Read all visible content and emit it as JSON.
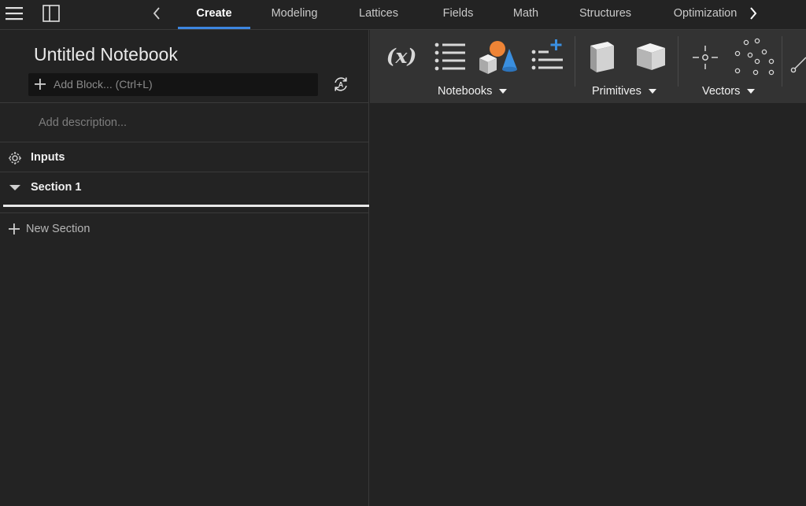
{
  "topbar": {
    "tabs": [
      {
        "label": "Create",
        "active": true
      },
      {
        "label": "Modeling",
        "active": false
      },
      {
        "label": "Lattices",
        "active": false
      },
      {
        "label": "Fields",
        "active": false
      },
      {
        "label": "Math",
        "active": false
      },
      {
        "label": "Structures",
        "active": false
      },
      {
        "label": "Optimization",
        "active": false
      }
    ]
  },
  "notebook": {
    "title": "Untitled Notebook",
    "add_block_placeholder": "Add Block... (Ctrl+L)",
    "description_placeholder": "Add description...",
    "inputs_label": "Inputs",
    "section_label": "Section 1",
    "new_section_label": "New Section"
  },
  "ribbon": {
    "icons": [
      "variable-icon",
      "list-icon",
      "primitive-shapes-icon",
      "add-list-icon",
      "box-icon",
      "cube-icon",
      "point-icon",
      "point-cloud-icon",
      "line-icon"
    ],
    "groups": {
      "notebooks": "Notebooks",
      "primitives": "Primitives",
      "vectors": "Vectors"
    }
  },
  "colors": {
    "accent": "#3d86e0",
    "background": "#232323",
    "ribbon": "#333333",
    "input_bg": "#141414"
  }
}
